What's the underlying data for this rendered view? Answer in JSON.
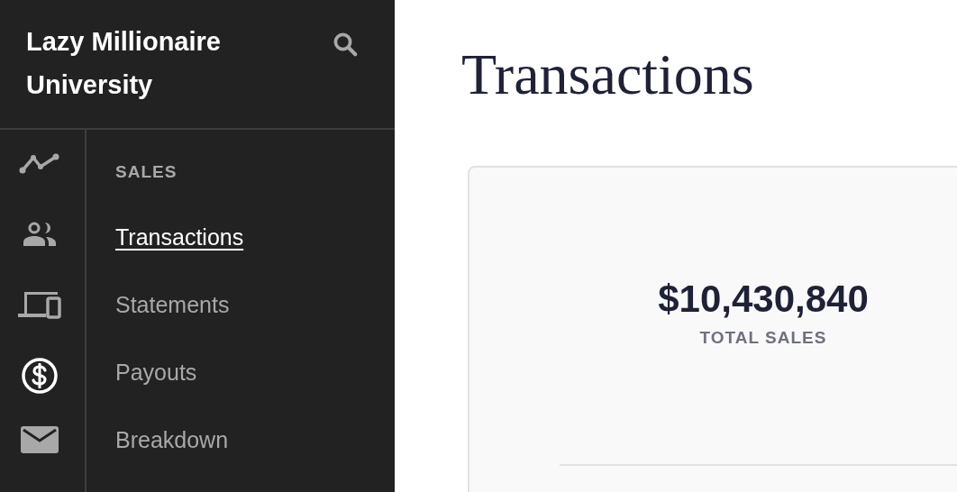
{
  "sidebar": {
    "brand": "Lazy Millionaire University",
    "rail": [
      {
        "kind": "chart",
        "selected": false
      },
      {
        "kind": "people",
        "selected": false
      },
      {
        "kind": "devices",
        "selected": false
      },
      {
        "kind": "dollar",
        "selected": true
      },
      {
        "kind": "mail",
        "selected": false
      }
    ],
    "section": "SALES",
    "items": [
      {
        "label": "Transactions",
        "selected": true
      },
      {
        "label": "Statements",
        "selected": false
      },
      {
        "label": "Payouts",
        "selected": false
      },
      {
        "label": "Breakdown",
        "selected": false
      }
    ]
  },
  "page": {
    "title": "Transactions"
  },
  "card": {
    "value": "$10,430,840",
    "caption": "TOTAL SALES"
  }
}
